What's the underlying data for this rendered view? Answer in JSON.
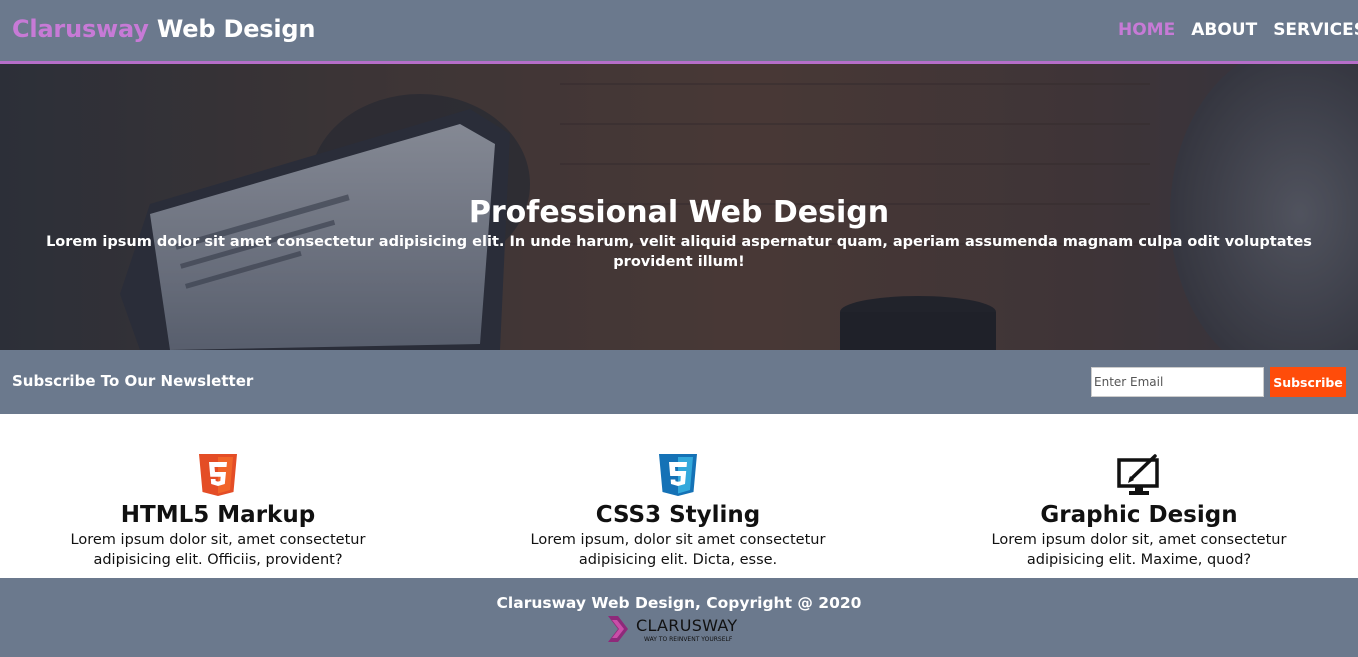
{
  "header": {
    "logo_brand": "Clarusway",
    "logo_rest": " Web Design",
    "nav": [
      {
        "label": "HOME",
        "active": true
      },
      {
        "label": "ABOUT",
        "active": false
      },
      {
        "label": "SERVICES",
        "active": false
      }
    ]
  },
  "hero": {
    "title": "Professional Web Design",
    "text": "Lorem ipsum dolor sit amet consectetur adipisicing elit. In unde harum, velit aliquid aspernatur quam, aperiam assumenda magnam culpa odit voluptates provident illum!"
  },
  "newsletter": {
    "label": "Subscribe To Our Newsletter",
    "email_placeholder": "Enter Email",
    "button_label": "Subscribe"
  },
  "features": [
    {
      "icon": "html5-icon",
      "title": "HTML5 Markup",
      "text": "Lorem ipsum dolor sit, amet consectetur adipisicing elit. Officiis, provident?"
    },
    {
      "icon": "css3-icon",
      "title": "CSS3 Styling",
      "text": "Lorem ipsum, dolor sit amet consectetur adipisicing elit. Dicta, esse."
    },
    {
      "icon": "graphic-design-icon",
      "title": "Graphic Design",
      "text": "Lorem ipsum dolor sit, amet consectetur adipisicing elit. Maxime, quod?"
    }
  ],
  "footer": {
    "copyright": "Clarusway Web Design, Copyright @ 2020",
    "logo_name": "CLARUSWAY",
    "logo_tagline": "WAY TO REINVENT YOURSELF"
  },
  "colors": {
    "bar": "#6b798d",
    "accent_purple": "#c77ad6",
    "subscribe_orange": "#ff4c0a",
    "html5_orange": "#e44d26",
    "css3_blue": "#1572b6"
  }
}
